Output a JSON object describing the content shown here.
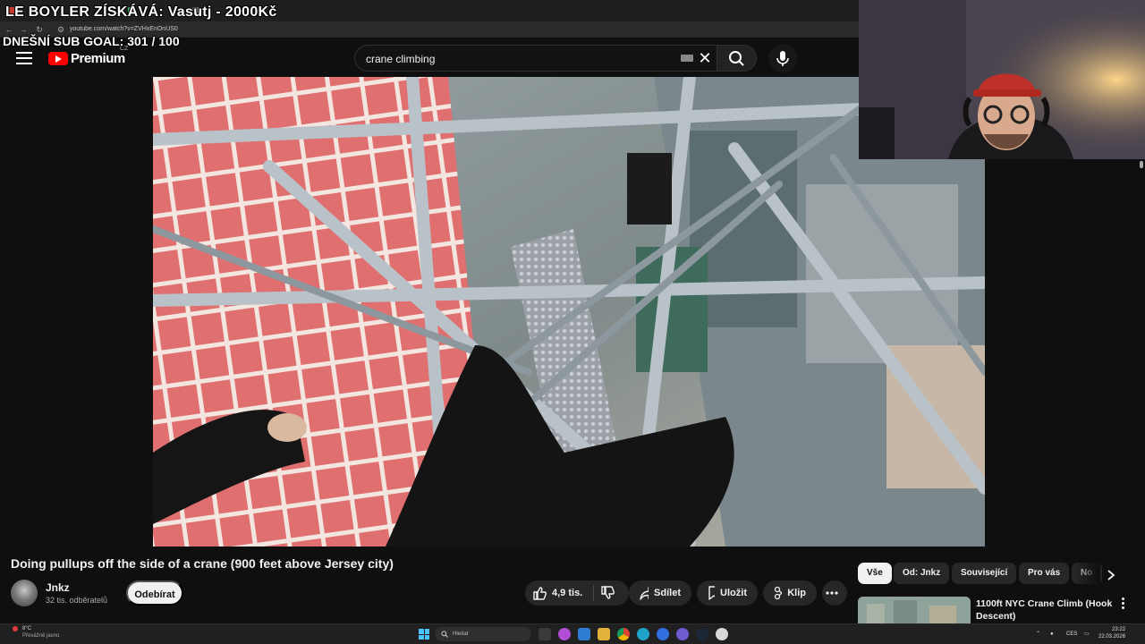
{
  "overlay": {
    "title": "LE BOYLER ZÍSKÁVÁ: Vasutj - 2000Kč",
    "sub_goal": "DNEŠNÍ SUB GOAL: 301 / 100"
  },
  "browser": {
    "url": "youtube.com/watch?v=ZVHxEnOnUS0",
    "icons": [
      "back-icon",
      "forward-icon",
      "reload-icon",
      "site-info-icon"
    ]
  },
  "masthead": {
    "logo_text": "Premium",
    "country_code": "CZ",
    "search_value": "crane climbing",
    "icons": [
      "menu-icon",
      "youtube-logo",
      "keyboard-icon",
      "clear-icon",
      "search-icon",
      "mic-icon"
    ]
  },
  "video": {
    "title": "Doing pullups off the side of a crane (900 feet above Jersey city)",
    "channel": "Jnkz",
    "subscribers": "32 tis. odběratelů",
    "subscribe_label": "Odebírat",
    "likes": "4,9 tis.",
    "share_label": "Sdílet",
    "save_label": "Uložit",
    "clip_label": "Klip"
  },
  "chips": [
    "Vše",
    "Od: Jnkz",
    "Související",
    "Pro vás",
    "No"
  ],
  "recommendation": {
    "title": "1100ft NYC Crane Climb (Hook Descent)"
  },
  "taskbar": {
    "weather_temp": "8°C",
    "weather_desc": "Převážně jasno",
    "search_placeholder": "Hledat",
    "language": "CES",
    "time": "23:22",
    "date": "22.03.2026"
  },
  "colors": {
    "background": "#0f0f0f",
    "youtube_red": "#ff0000",
    "pill": "#272727",
    "chip_active": "#f1f1f1"
  }
}
